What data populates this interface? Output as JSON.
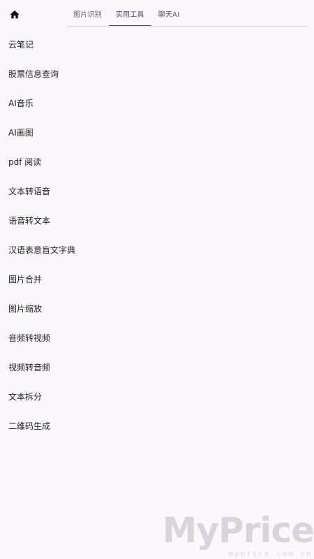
{
  "header": {
    "home_icon": "home-icon",
    "tabs": [
      {
        "label": "图片识别",
        "active": false
      },
      {
        "label": "实用工具",
        "active": true
      },
      {
        "label": "聊天AI",
        "active": false
      }
    ]
  },
  "list": {
    "items": [
      {
        "label": "云笔记"
      },
      {
        "label": "股票信息查询"
      },
      {
        "label": "AI音乐"
      },
      {
        "label": "AI画图"
      },
      {
        "label": "pdf 阅读"
      },
      {
        "label": "文本转语音"
      },
      {
        "label": "语音转文本"
      },
      {
        "label": "汉语表意盲文字典"
      },
      {
        "label": "图片合并"
      },
      {
        "label": "图片缩放"
      },
      {
        "label": "音频转视频"
      },
      {
        "label": "视频转音频"
      },
      {
        "label": "文本拆分"
      },
      {
        "label": "二维码生成"
      }
    ]
  },
  "watermark": {
    "brand": "MyPrice",
    "url": "myprice.com.cn"
  },
  "colors": {
    "background": "#fcf7fc",
    "accent": "#5b4c8f",
    "text": "#222222"
  }
}
